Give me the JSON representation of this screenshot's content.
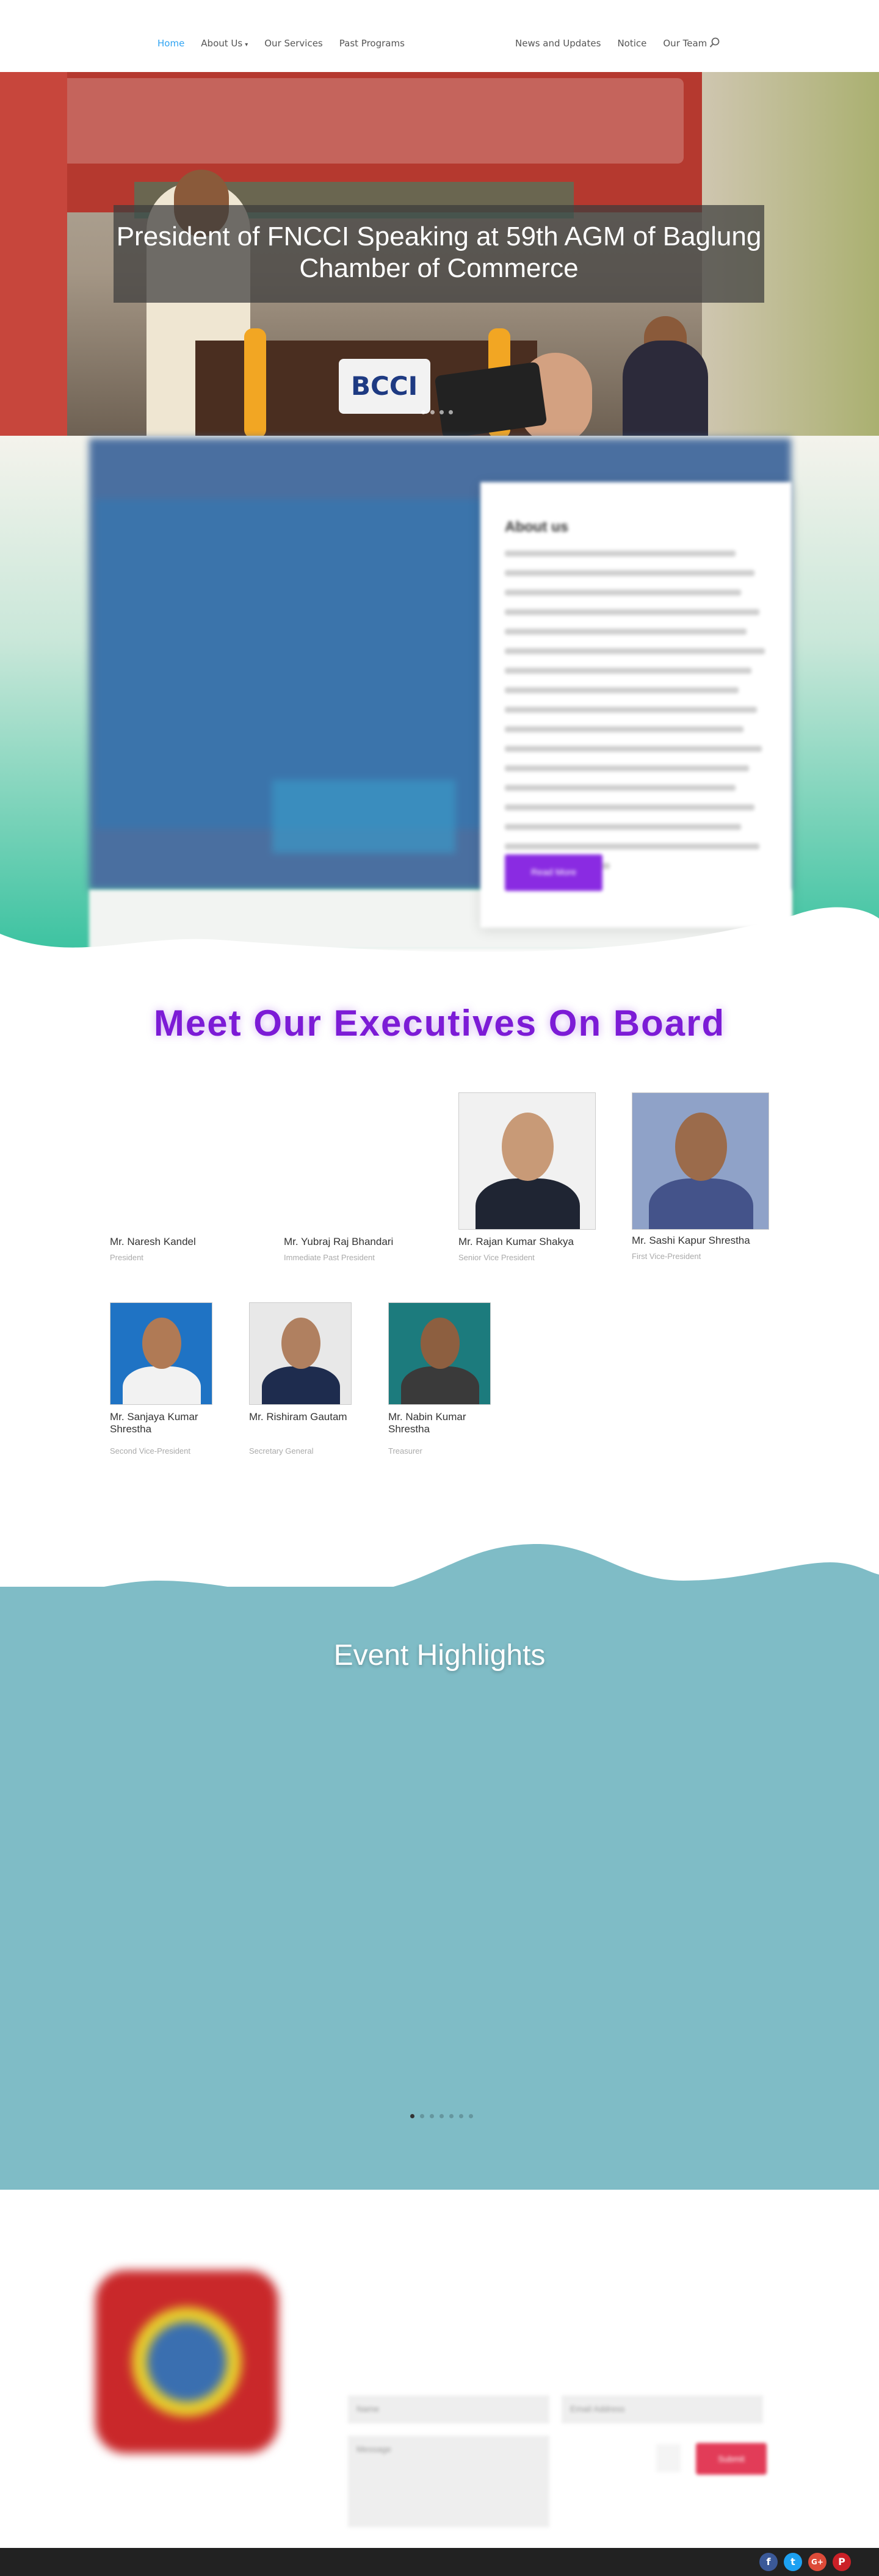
{
  "nav": {
    "left": [
      {
        "label": "Home",
        "active": true
      },
      {
        "label": "About Us",
        "has_dropdown": true
      },
      {
        "label": "Our Services"
      },
      {
        "label": "Past Programs"
      }
    ],
    "right": [
      {
        "label": "News and Updates"
      },
      {
        "label": "Notice"
      },
      {
        "label": "Our Team"
      }
    ],
    "search_icon": "search-icon",
    "active_color": "#2ea3f2"
  },
  "hero": {
    "caption": "President of FNCCI Speaking at 59th AGM of Baglung Chamber of Commerce",
    "podium_text": "BCCI",
    "slide_count": 4
  },
  "about": {
    "heading": "About us",
    "button_label": "Read More",
    "button_color": "#8a2be2"
  },
  "executives": {
    "title": "Meet Our Executives On Board",
    "title_color": "#7c1bd6",
    "members": [
      {
        "name": "Mr. Naresh Kandel",
        "role": "President",
        "photo": false
      },
      {
        "name": "Mr. Yubraj Raj Bhandari",
        "role": "Immediate Past President",
        "photo": false
      },
      {
        "name": "Mr. Rajan Kumar Shakya",
        "role": "Senior Vice President",
        "photo": true
      },
      {
        "name": "Mr. Sashi Kapur Shrestha",
        "role": "First Vice-President",
        "photo": true
      },
      {
        "name": "Mr. Sanjaya Kumar Shrestha",
        "role": "Second Vice-President",
        "photo": true
      },
      {
        "name": "Mr. Rishiram Gautam",
        "role": "Secretary General",
        "photo": true
      },
      {
        "name": "Mr. Nabin Kumar Shrestha",
        "role": "Treasurer",
        "photo": true
      }
    ]
  },
  "events": {
    "title": "Event Highlights",
    "background": "#7fbcc6",
    "slide_count": 7,
    "active_slide": 1
  },
  "contact": {
    "name_placeholder": "Name",
    "email_placeholder": "Email Address",
    "message_placeholder": "Message",
    "submit_label": "Submit",
    "submit_color": "#e23c58"
  },
  "footer": {
    "social": [
      {
        "icon": "facebook-icon",
        "glyph": "f",
        "color": "#3b5998"
      },
      {
        "icon": "twitter-icon",
        "glyph": "t",
        "color": "#1da1f2"
      },
      {
        "icon": "google-plus-icon",
        "glyph": "G+",
        "color": "#dd4b39"
      },
      {
        "icon": "pinterest-icon",
        "glyph": "P",
        "color": "#cb2027"
      }
    ]
  }
}
